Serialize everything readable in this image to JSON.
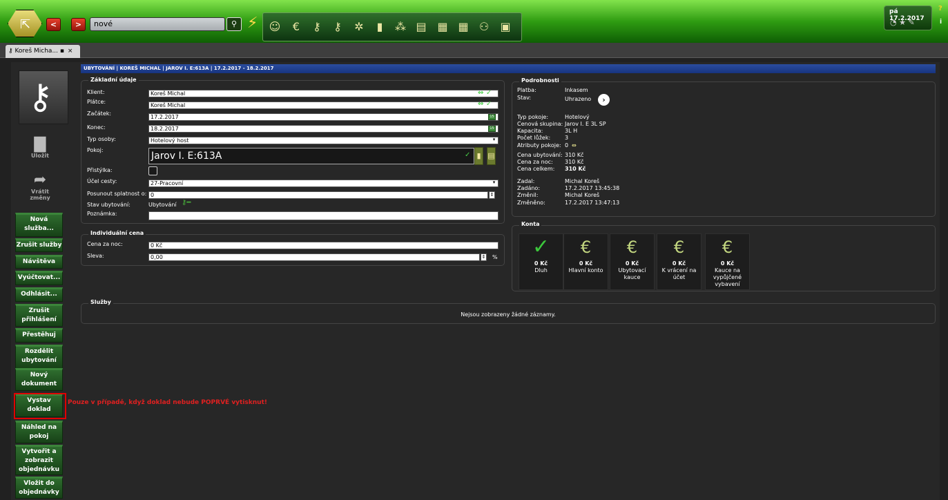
{
  "topbar": {
    "search_value": "nové",
    "back_label": "<",
    "forward_label": ">",
    "date": "pá 17.2.2017",
    "help": "?",
    "info": "i",
    "toolbar_icons": [
      "guest-icon",
      "money-icon",
      "key-icon",
      "key-icon",
      "key-multi-icon",
      "door-icon",
      "group-icon",
      "door-card-icon",
      "building-icon",
      "building-icon",
      "people-ab-icon",
      "presentation-icon"
    ]
  },
  "tab": {
    "label": "Koreš Micha...",
    "close": "×"
  },
  "header": "UBYTOVÁNÍ | KOREŠ MICHAL | JAROV I. E:613A | 17.2.2017 - 18.2.2017",
  "sidebar": {
    "save_label": "Uložit",
    "revert_label_1": "Vrátit",
    "revert_label_2": "změny",
    "actions": [
      {
        "l1": "Nová",
        "l2": "služba..."
      },
      {
        "l1": "Zrušit služby",
        "l2": ""
      },
      {
        "l1": "Návštěva",
        "l2": ""
      },
      {
        "l1": "Vyúčtovat...",
        "l2": ""
      },
      {
        "l1": "Odhlásit...",
        "l2": ""
      },
      {
        "l1": "Zrušit",
        "l2": "přihlášení"
      },
      {
        "l1": "Přestěhuj",
        "l2": ""
      },
      {
        "l1": "Rozdělit",
        "l2": "ubytování"
      },
      {
        "l1": "Nový",
        "l2": "dokument"
      },
      {
        "l1": "Vystav",
        "l2": "doklad"
      },
      {
        "l1": "Náhled na",
        "l2": "pokoj"
      },
      {
        "l1": "Vytvořit a",
        "l2": "zobrazit",
        "l3": "objednávku"
      },
      {
        "l1": "Vložit do",
        "l2": "objednávky"
      }
    ],
    "note": "Pouze v případě, když doklad nebude POPRVÉ vytisknut!"
  },
  "zakladni": {
    "title": "Základní údaje",
    "klient_label": "Klient:",
    "klient_value": "Koreš Michal",
    "platce_label": "Plátce:",
    "platce_value": "Koreš Michal",
    "zacatek_label": "Začátek:",
    "zacatek_value": "17.2.2017",
    "konec_label": "Konec:",
    "konec_value": "18.2.2017",
    "typ_label": "Typ osoby:",
    "typ_value": "Hotelový host",
    "pokoj_label": "Pokoj:",
    "pokoj_value": "Jarov I. E:613A",
    "pristylka_label": "Přistýlka:",
    "ucel_label": "Účel cesty:",
    "ucel_value": "27-Pracovní",
    "posunout_label": "Posunout splatnost o:",
    "posunout_value": "0",
    "stav_label": "Stav ubytování:",
    "stav_value": "Ubytování",
    "poznamka_label": "Poznámka:",
    "poznamka_value": ""
  },
  "individualni": {
    "title": "Individuální cena",
    "cena_label": "Cena za noc:",
    "cena_value": "0 Kč",
    "sleva_label": "Sleva:",
    "sleva_value": "0,00",
    "sleva_unit": "%"
  },
  "podrobnosti": {
    "title": "Podrobnosti",
    "rows": [
      {
        "label": "Platba:",
        "value": "Inkasem"
      },
      {
        "label": "Stav:",
        "value": "Uhrazeno"
      },
      {
        "label": "Typ pokoje:",
        "value": "Hotelový"
      },
      {
        "label": "Cenová skupina:",
        "value": "Jarov I. E 3L SP"
      },
      {
        "label": "Kapacita:",
        "value": "3L H"
      },
      {
        "label": "Počet lůžek:",
        "value": "3"
      },
      {
        "label": "Atributy pokoje:",
        "value": "0"
      },
      {
        "label": "Cena ubytování:",
        "value": "310 Kč"
      },
      {
        "label": "Cena za noc:",
        "value": "310 Kč"
      },
      {
        "label": "Cena celkem:",
        "value": "310 Kč"
      },
      {
        "label": "Zadal:",
        "value": "Michal Koreš"
      },
      {
        "label": "Zadáno:",
        "value": "17.2.2017 13:45:38"
      },
      {
        "label": "Změnil:",
        "value": "Michal Koreš"
      },
      {
        "label": "Změněno:",
        "value": "17.2.2017 13:47:13"
      }
    ]
  },
  "konta": {
    "title": "Konta",
    "items": [
      {
        "value": "0 Kč",
        "l1": "Dluh",
        "l2": "",
        "l3": "",
        "icon": "check-icon"
      },
      {
        "value": "0 Kč",
        "l1": "Hlavní konto",
        "l2": "",
        "l3": "",
        "icon": "euro-icon"
      },
      {
        "value": "0 Kč",
        "l1": "Ubytovací",
        "l2": "kauce",
        "l3": "",
        "icon": "euro-icon"
      },
      {
        "value": "0 Kč",
        "l1": "K vrácení na",
        "l2": "účet",
        "l3": "",
        "icon": "euro-icon"
      },
      {
        "value": "0 Kč",
        "l1": "Kauce na",
        "l2": "vypůjčené",
        "l3": "vybavení",
        "icon": "euro-icon"
      }
    ]
  },
  "sluzby": {
    "title": "Služby",
    "empty": "Nejsou zobrazeny žádné záznamy."
  },
  "colors": {
    "brand_green": "#2f9c12",
    "header_blue": "#1f3f8f",
    "action_green": "#236023",
    "alert_red": "#e00000"
  }
}
